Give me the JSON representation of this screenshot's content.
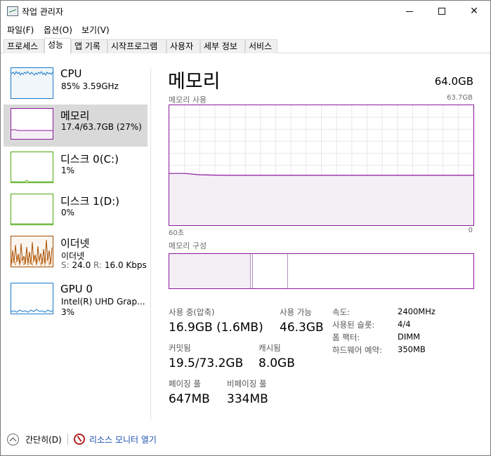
{
  "window": {
    "title": "작업 관리자",
    "controls": {
      "minimize": "minimize-icon",
      "maximize": "maximize-icon",
      "close": "✕"
    }
  },
  "menu": [
    "파일(F)",
    "옵션(O)",
    "보기(V)"
  ],
  "tabs": [
    "프로세스",
    "성능",
    "앱 기록",
    "시작프로그램",
    "사용자",
    "세부 정보",
    "서비스"
  ],
  "active_tab": "성능",
  "sidebar": {
    "items": [
      {
        "title": "CPU",
        "line1": "85% 3.59GHz",
        "line2": "",
        "graph_color": "#1979c9"
      },
      {
        "title": "메모리",
        "line1": "17.4/63.7GB (27%)",
        "line2": "",
        "graph_color": "#8b1a9b"
      },
      {
        "title": "디스크 0(C:)",
        "line1": "1%",
        "line2": "",
        "graph_color": "#4da60c"
      },
      {
        "title": "디스크 1(D:)",
        "line1": "0%",
        "line2": "",
        "graph_color": "#4da60c"
      },
      {
        "title": "이더넷",
        "line1": "이더넷",
        "line2_s": "S:",
        "line2_s_val": "24.0",
        "line2_r": "R:",
        "line2_r_val": "16.0 Kbps",
        "graph_color": "#a74f01"
      },
      {
        "title": "GPU 0",
        "line1": "Intel(R) UHD Grap...",
        "line2": "3%",
        "graph_color": "#1979c9"
      }
    ],
    "selected": "메모리"
  },
  "main": {
    "title": "메모리",
    "capacity": "64.0GB",
    "usage_label": "메모리 사용",
    "usage_max": "63.7GB",
    "axis_left": "60초",
    "axis_right": "0",
    "composition_label": "메모리 구성",
    "accent": "#8b1a9b",
    "stats": {
      "in_use_label": "사용 중(압축)",
      "in_use_value": "16.9GB (1.6MB)",
      "available_label": "사용 가능",
      "available_value": "46.3GB",
      "committed_label": "커밋됨",
      "committed_value": "19.5/73.2GB",
      "cached_label": "캐시됨",
      "cached_value": "8.0GB",
      "paged_label": "페이징 풀",
      "paged_value": "647MB",
      "nonpaged_label": "비페이징 풀",
      "nonpaged_value": "334MB"
    },
    "details": [
      {
        "label": "속도:",
        "value": "2400MHz"
      },
      {
        "label": "사용된 슬롯:",
        "value": "4/4"
      },
      {
        "label": "폼 팩터:",
        "value": "DIMM"
      },
      {
        "label": "하드웨어 예약:",
        "value": "350MB"
      }
    ]
  },
  "chart_data": {
    "type": "area",
    "x": [
      60,
      57,
      54,
      51,
      48,
      45,
      0
    ],
    "y": [
      27.5,
      27.5,
      26.8,
      26.6,
      26.5,
      26.5,
      26.5
    ],
    "ylim": [
      0,
      63.7
    ],
    "xlim": [
      60,
      0
    ],
    "grid": true
  },
  "footer": {
    "collapse": "간단히(D)",
    "resource_monitor": "리소스 모니터 열기"
  }
}
